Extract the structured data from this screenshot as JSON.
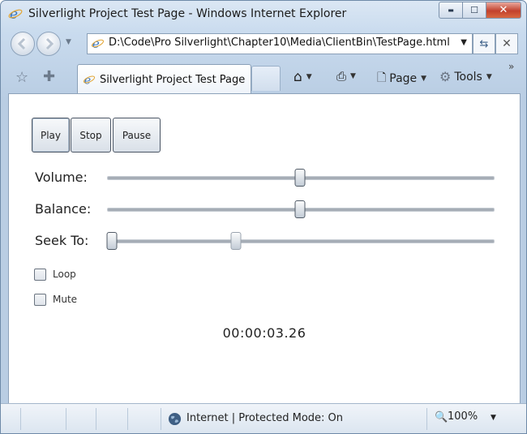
{
  "window": {
    "title": "Silverlight Project Test Page - Windows Internet Explorer",
    "caption": {
      "minimize": "▬",
      "maximize": "☐",
      "close": "✕"
    }
  },
  "address": {
    "url": "D:\\Code\\Pro Silverlight\\Chapter10\\Media\\ClientBin\\TestPage.html"
  },
  "tab": {
    "label": "Silverlight Project Test Page"
  },
  "commands": {
    "page": "Page",
    "tools": "Tools"
  },
  "player": {
    "buttons": {
      "play": "Play",
      "stop": "Stop",
      "pause": "Pause"
    },
    "sliders": {
      "volume": {
        "label": "Volume:",
        "value": 0.5
      },
      "balance": {
        "label": "Balance:",
        "value": 0.5
      },
      "seek": {
        "label": "Seek To:",
        "value": 0.0,
        "buffer_marker": 0.33
      }
    },
    "checkboxes": {
      "loop": {
        "label": "Loop",
        "checked": false
      },
      "mute": {
        "label": "Mute",
        "checked": false
      }
    },
    "time": "00:00:03.26"
  },
  "status": {
    "zone": "Internet | Protected Mode: On",
    "zoom": "100%"
  },
  "icons": [
    "ie-logo-icon",
    "back-icon",
    "forward-icon",
    "refresh-icon",
    "stop-icon",
    "favorites-star-icon",
    "add-favorites-icon",
    "home-icon",
    "print-icon",
    "page-icon",
    "tools-gear-icon",
    "globe-icon",
    "zoom-icon"
  ],
  "colors": {
    "window_chrome": "#c9dbee",
    "close_button": "#c2412d",
    "track": "#a6adb6"
  }
}
